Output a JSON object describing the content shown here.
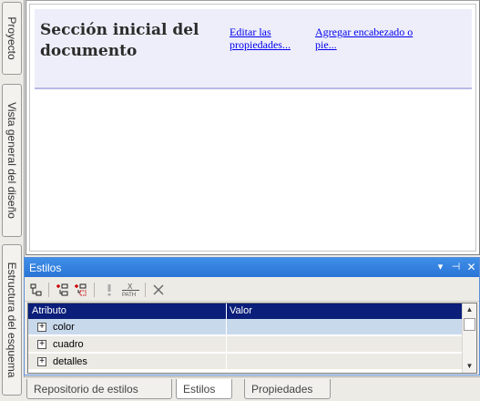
{
  "left_tabs": {
    "proyecto": "Proyecto",
    "vista": "Vista general del diseño",
    "estructura": "Estructura del esquema"
  },
  "design": {
    "section_title": "Sección inicial del documento",
    "edit_props_link": "Editar las propiedades...",
    "add_header_link": "Agregar encabezado o pie..."
  },
  "styles_panel": {
    "title": "Estilos",
    "controls": [
      "▾",
      "⊣",
      "✕"
    ],
    "toolbar_icons": [
      "tree-view-icon",
      "add-selector-icon",
      "add-style-icon",
      "priority-icon",
      "xpath-icon",
      "delete-icon"
    ],
    "columns": [
      "Atributo",
      "Valor"
    ],
    "rows": [
      {
        "name": "color",
        "value": ""
      },
      {
        "name": "cuadro",
        "value": ""
      },
      {
        "name": "detalles",
        "value": ""
      }
    ]
  },
  "bottom_tabs": [
    "Repositorio de estilos",
    "Estilos",
    "Propiedades"
  ],
  "colors": {
    "panel_title": "#2a74d6",
    "grid_header": "#0a1e7a",
    "selected_row": "#c9d9ec",
    "section_band": "#eeeefa",
    "link": "#0000ee"
  }
}
